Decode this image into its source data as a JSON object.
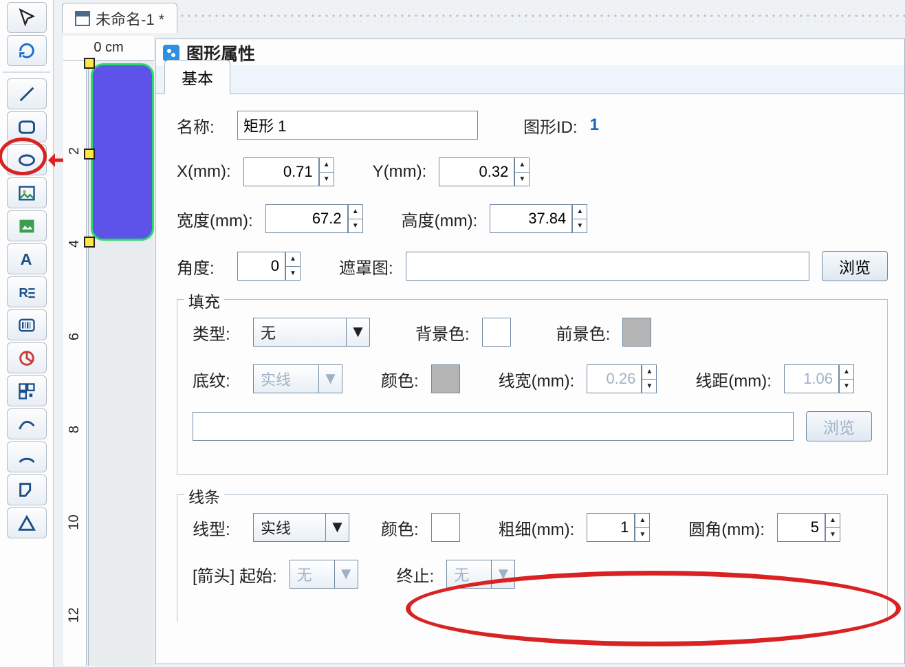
{
  "doc": {
    "tab_title": "未命名-1 *"
  },
  "ruler": {
    "unit_label": "0 cm",
    "ticks": [
      "2",
      "4",
      "6",
      "8",
      "10",
      "12"
    ]
  },
  "panel": {
    "title": "图形属性",
    "tab_basic": "基本",
    "name_label": "名称:",
    "name_value": "矩形 1",
    "shape_id_label": "图形ID:",
    "shape_id_value": "1",
    "x_label": "X(mm):",
    "x_value": "0.71",
    "y_label": "Y(mm):",
    "y_value": "0.32",
    "width_label": "宽度(mm):",
    "width_value": "67.2",
    "height_label": "高度(mm):",
    "height_value": "37.84",
    "angle_label": "角度:",
    "angle_value": "0",
    "mask_label": "遮罩图:",
    "browse": "浏览",
    "fill": {
      "legend": "填充",
      "type_label": "类型:",
      "type_value": "无",
      "bg_label": "背景色:",
      "fg_label": "前景色:",
      "pattern_label": "底纹:",
      "pattern_value": "实线",
      "color_label": "颜色:",
      "lw_label": "线宽(mm):",
      "lw_value": "0.26",
      "ld_label": "线距(mm):",
      "ld_value": "1.06"
    },
    "line": {
      "legend": "线条",
      "style_label": "线型:",
      "style_value": "实线",
      "color_label": "颜色:",
      "weight_label": "粗细(mm):",
      "weight_value": "1",
      "radius_label": "圆角(mm):",
      "radius_value": "5",
      "arrow_label": "[箭头] 起始:",
      "arrow_start": "无",
      "arrow_end_label": "终止:",
      "arrow_end": "无"
    }
  },
  "tools": {
    "pointer": "pointer",
    "refresh": "refresh",
    "line": "line",
    "roundrect": "roundrect",
    "ellipse": "ellipse",
    "image": "image",
    "picture": "picture",
    "text": "text",
    "richtext": "richtext",
    "barcode": "barcode",
    "chart": "chart",
    "qr": "qr",
    "curve": "curve",
    "arc": "arc",
    "polygon": "polygon",
    "triangle": "triangle"
  }
}
